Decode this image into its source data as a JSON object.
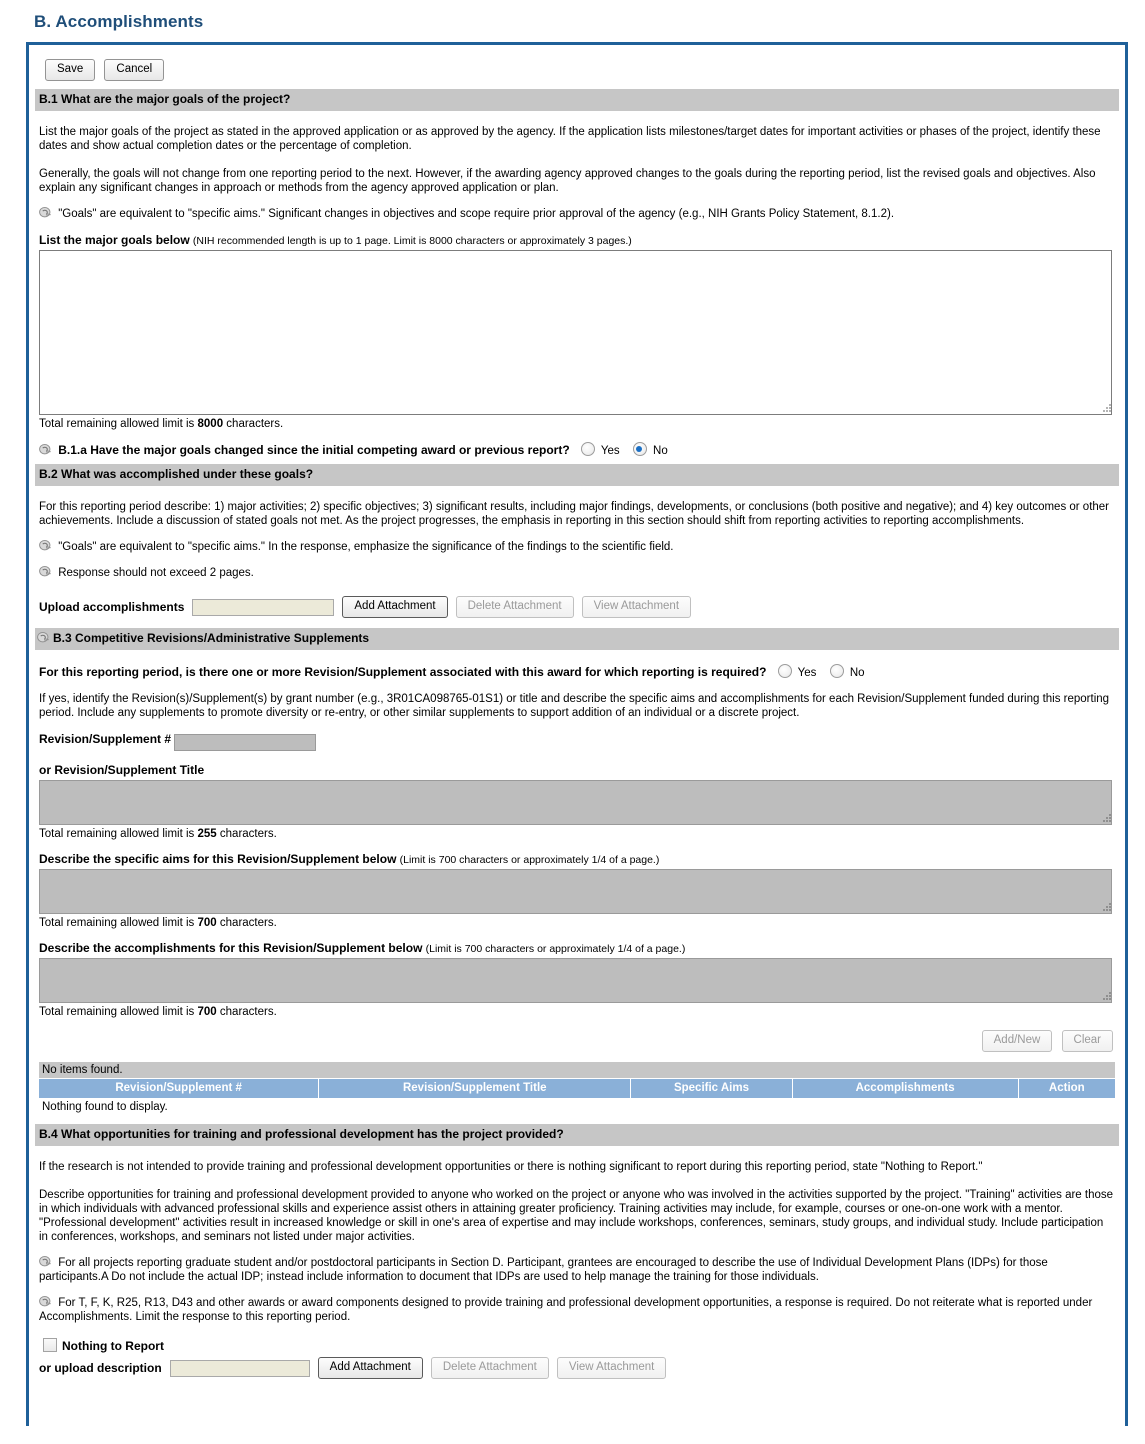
{
  "page": {
    "title": "B. Accomplishments"
  },
  "toolbar": {
    "save_label": "Save",
    "cancel_label": "Cancel"
  },
  "b1": {
    "header": "B.1 What are the major goals of the project?",
    "para1": "List the major goals of the project as stated in the approved application or as approved by the agency. If the application lists milestones/target dates for important activities or phases of the project, identify these dates and show actual completion dates or the percentage of completion.",
    "para2": "Generally, the goals will not change from one reporting period to the next. However, if the awarding agency approved changes to the goals during the reporting period, list the revised goals and objectives. Also explain any significant changes in approach or methods from the agency approved application or plan.",
    "note1": "\"Goals\" are equivalent to \"specific aims.\" Significant changes in objectives and scope require prior approval of the agency (e.g., NIH Grants Policy Statement, 8.1.2).",
    "field_label": "List the major goals below",
    "field_hint": "(NIH recommended length is up to 1 page. Limit is 8000 characters or approximately 3 pages.)",
    "textarea_value": "",
    "limit_prefix": "Total remaining allowed limit is ",
    "limit_number": "8000",
    "limit_suffix": " characters."
  },
  "b1a": {
    "question": "B.1.a Have the major goals changed since the initial competing award or previous report?",
    "yes_label": "Yes",
    "no_label": "No",
    "selected": "No"
  },
  "b2": {
    "header": "B.2 What was accomplished under these goals?",
    "para1": "For this reporting period describe: 1) major activities; 2) specific objectives; 3) significant results, including major findings, developments, or conclusions (both positive and negative); and 4) key outcomes or other achievements. Include a discussion of stated goals not met. As the project progresses, the emphasis in reporting in this section should shift from reporting activities to reporting accomplishments.",
    "note1": "\"Goals\" are equivalent to \"specific aims.\" In the response, emphasize the significance of the findings to the scientific field.",
    "note2": "Response should not exceed 2 pages.",
    "upload_label": "Upload accomplishments",
    "upload_value": "",
    "add_attachment": "Add Attachment",
    "delete_attachment": "Delete Attachment",
    "view_attachment": "View Attachment"
  },
  "b3": {
    "header": "B.3 Competitive Revisions/Administrative Supplements",
    "question": "For this reporting period, is there one or more Revision/Supplement associated with this award for which reporting is required?",
    "yes_label": "Yes",
    "no_label": "No",
    "selected": "",
    "para1": "If yes, identify the Revision(s)/Supplement(s) by grant number (e.g., 3R01CA098765-01S1) or title and describe the specific aims and accomplishments for each Revision/Supplement funded during this reporting period. Include any supplements to promote diversity or re-entry, or other similar supplements to support addition of an individual or a discrete project.",
    "num_label": "Revision/Supplement #",
    "num_value": "",
    "title_label": "or Revision/Supplement Title",
    "title_value": "",
    "title_limit_prefix": "Total remaining allowed limit is ",
    "title_limit_number": "255",
    "title_limit_suffix": " characters.",
    "aims_label": "Describe the specific aims for this Revision/Supplement below",
    "aims_hint": "(Limit is 700 characters or approximately 1/4 of a page.)",
    "aims_value": "",
    "aims_limit_prefix": "Total remaining allowed limit is ",
    "aims_limit_number": "700",
    "aims_limit_suffix": " characters.",
    "accomp_label": "Describe the accomplishments for this Revision/Supplement below",
    "accomp_hint": "(Limit is 700 characters or approximately 1/4 of a page.)",
    "accomp_value": "",
    "accomp_limit_prefix": "Total remaining allowed limit is ",
    "accomp_limit_number": "700",
    "accomp_limit_suffix": " characters.",
    "add_new": "Add/New",
    "clear": "Clear",
    "no_items": "No items found.",
    "table_headers": [
      "Revision/Supplement #",
      "Revision/Supplement Title",
      "Specific Aims",
      "Accomplishments",
      "Action"
    ],
    "empty_message": "Nothing found to display."
  },
  "b4": {
    "header": "B.4 What opportunities for training and professional development has the project provided?",
    "para1": "If the research is not intended to provide training and professional development opportunities or there is nothing significant to report during this reporting period, state \"Nothing to Report.\"",
    "para2": "Describe opportunities for training and professional development provided to anyone who worked on the project or anyone who was involved in the activities supported by the project. \"Training\" activities are those in which individuals with advanced professional skills and experience assist others in attaining greater proficiency. Training activities may include, for example, courses or one-on-one work with a mentor. \"Professional development\" activities result in increased knowledge or skill in one's area of expertise and may include workshops, conferences, seminars, study groups, and individual study. Include participation in conferences, workshops, and seminars not listed under major activities.",
    "note1": "For all projects reporting graduate student and/or postdoctoral participants in Section D. Participant, grantees are encouraged to describe the use of Individual Development Plans (IDPs) for those participants.A Do not include the actual IDP; instead include information to document that IDPs are used to help manage the training for those individuals.",
    "note2": "For T, F, K, R25, R13, D43 and other awards or award components designed to provide training and professional development opportunities, a response is required. Do not reiterate what is reported under Accomplishments. Limit the response to this reporting period.",
    "nothing_to_report": "Nothing to Report",
    "nothing_checked": false,
    "upload_label": "or upload description",
    "upload_value": "",
    "add_attachment": "Add Attachment",
    "delete_attachment": "Delete Attachment",
    "view_attachment": "View Attachment"
  },
  "colors": {
    "title": "#1f4e79",
    "frame_border": "#1f6099",
    "section_bar": "#c6c6c6",
    "table_header": "#8ab0d8",
    "radio_dot": "#1b6fc4",
    "disabled_field": "#bdbdbd",
    "file_field": "#ecead9"
  }
}
